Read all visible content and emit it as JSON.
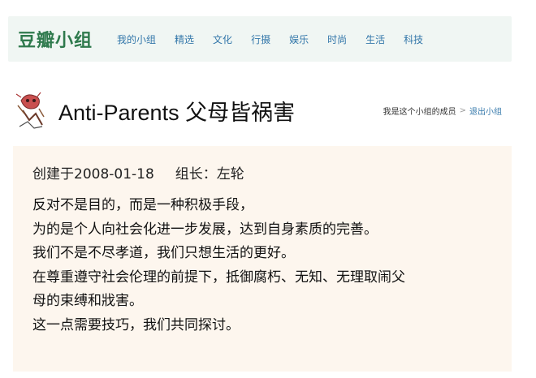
{
  "topbar": {
    "logo": "豆瓣小组",
    "nav": [
      "我的小组",
      "精选",
      "文化",
      "行摄",
      "娱乐",
      "时尚",
      "生活",
      "科技"
    ]
  },
  "group": {
    "title": "Anti-Parents 父母皆祸害",
    "member_status": "我是这个小组的成员",
    "separator": ">",
    "quit_label": "退出小组"
  },
  "info": {
    "created": "创建于2008-01-18",
    "leader": "组长：左轮",
    "description": [
      "反对不是目的，而是一种积极手段，",
      "为的是个人向社会化进一步发展，达到自身素质的完善。",
      "我们不是不尽孝道，我们只想生活的更好。",
      "在尊重遵守社会伦理的前提下，抵御腐朽、无知、无理取闹父",
      "母的束缚和戕害。",
      "这一点需要技巧，我们共同探讨。"
    ]
  },
  "colors": {
    "topbar_bg": "#f0f6f3",
    "logo": "#2f7a4d",
    "link": "#3377aa",
    "info_bg": "#fdf6ee"
  }
}
